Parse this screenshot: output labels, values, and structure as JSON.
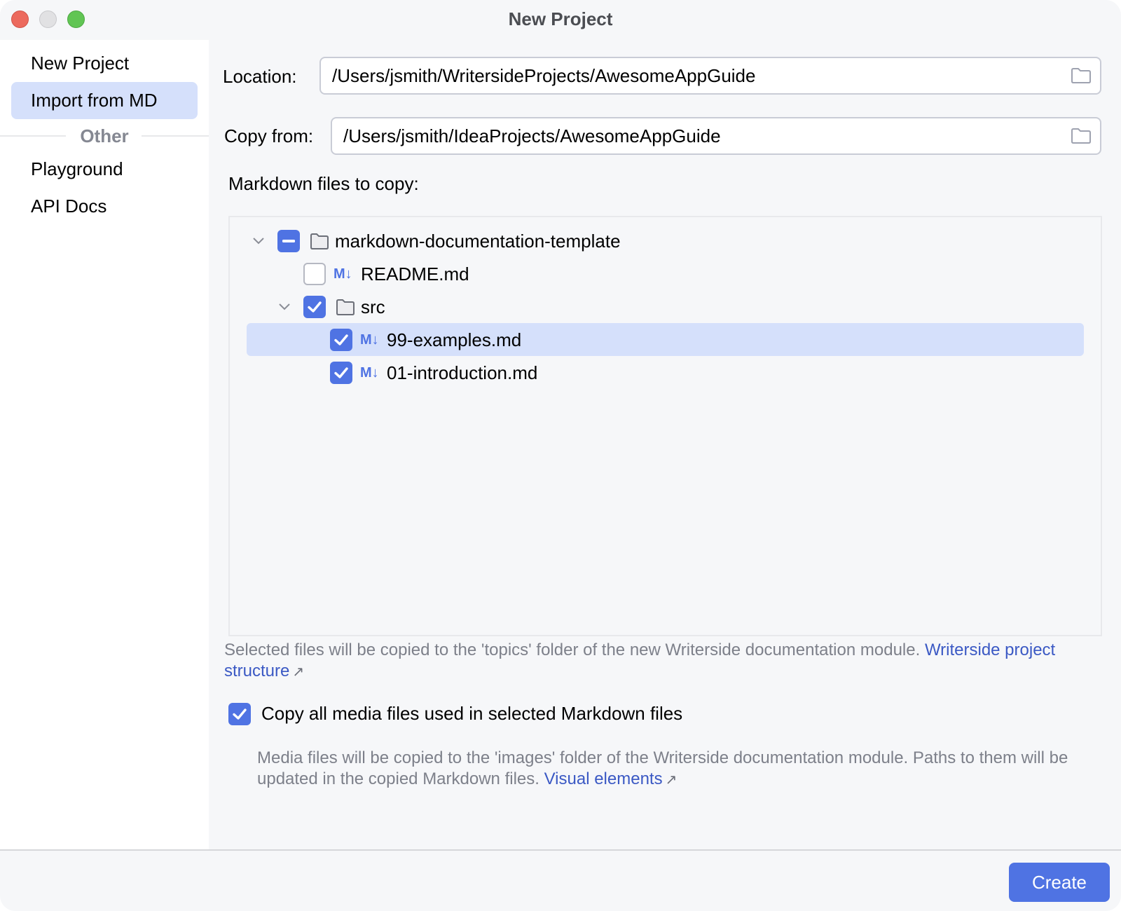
{
  "window": {
    "title": "New Project"
  },
  "sidebar": {
    "items": [
      {
        "label": "New Project",
        "selected": false
      },
      {
        "label": "Import from MD",
        "selected": true
      }
    ],
    "group_label": "Other",
    "other_items": [
      {
        "label": "Playground"
      },
      {
        "label": "API Docs"
      }
    ]
  },
  "form": {
    "location_label": "Location:",
    "location_value": "/Users/jsmith/WritersideProjects/AwesomeAppGuide",
    "copy_from_label": "Copy from:",
    "copy_from_value": "/Users/jsmith/IdeaProjects/AwesomeAppGuide",
    "files_label": "Markdown files to copy:"
  },
  "tree": {
    "md_badge": "M↓",
    "rows": [
      {
        "label": "markdown-documentation-template",
        "type": "folder",
        "state": "partial",
        "expanded": true,
        "depth": 0
      },
      {
        "label": "README.md",
        "type": "md",
        "state": "unchecked",
        "depth": 1
      },
      {
        "label": "src",
        "type": "folder",
        "state": "checked",
        "expanded": true,
        "depth": 1
      },
      {
        "label": "99-examples.md",
        "type": "md",
        "state": "checked",
        "depth": 2,
        "selected": true
      },
      {
        "label": "01-introduction.md",
        "type": "md",
        "state": "checked",
        "depth": 2
      }
    ]
  },
  "hints": {
    "topics_text": "Selected files will be copied to the 'topics' folder of the new Writerside documentation module.",
    "topics_link": "Writerside project structure",
    "media_checkbox_label": "Copy all media files used in selected Markdown files",
    "media_checkbox_checked": true,
    "media_text": "Media files will be copied to the 'images' folder of the Writerside documentation module. Paths to them will be updated in the copied Markdown files.",
    "media_link": "Visual elements",
    "ext_arrow": "↗"
  },
  "footer": {
    "create_label": "Create"
  },
  "colors": {
    "accent": "#4f73e3",
    "selection": "#d5e0fb",
    "link": "#3b59c4"
  }
}
